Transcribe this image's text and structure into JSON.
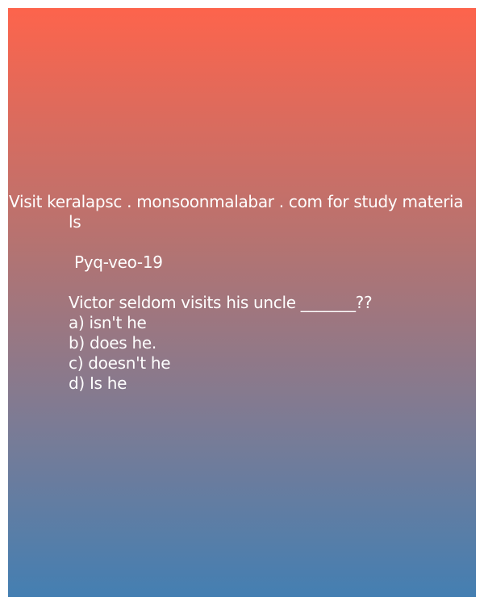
{
  "promo": {
    "line1": "Visit keralapsc . monsoonmalabar . com for study materia",
    "line2": "ls"
  },
  "question": {
    "code": "Pyq-veo-19",
    "text": "Victor seldom visits his uncle _______??",
    "options": [
      "a) isn't he",
      "b) does he.",
      "c) doesn't he",
      "d) Is he"
    ]
  },
  "colors": {
    "gradient_top": "#fd644c",
    "gradient_bottom": "#447fb2",
    "text": "#ffffff"
  }
}
